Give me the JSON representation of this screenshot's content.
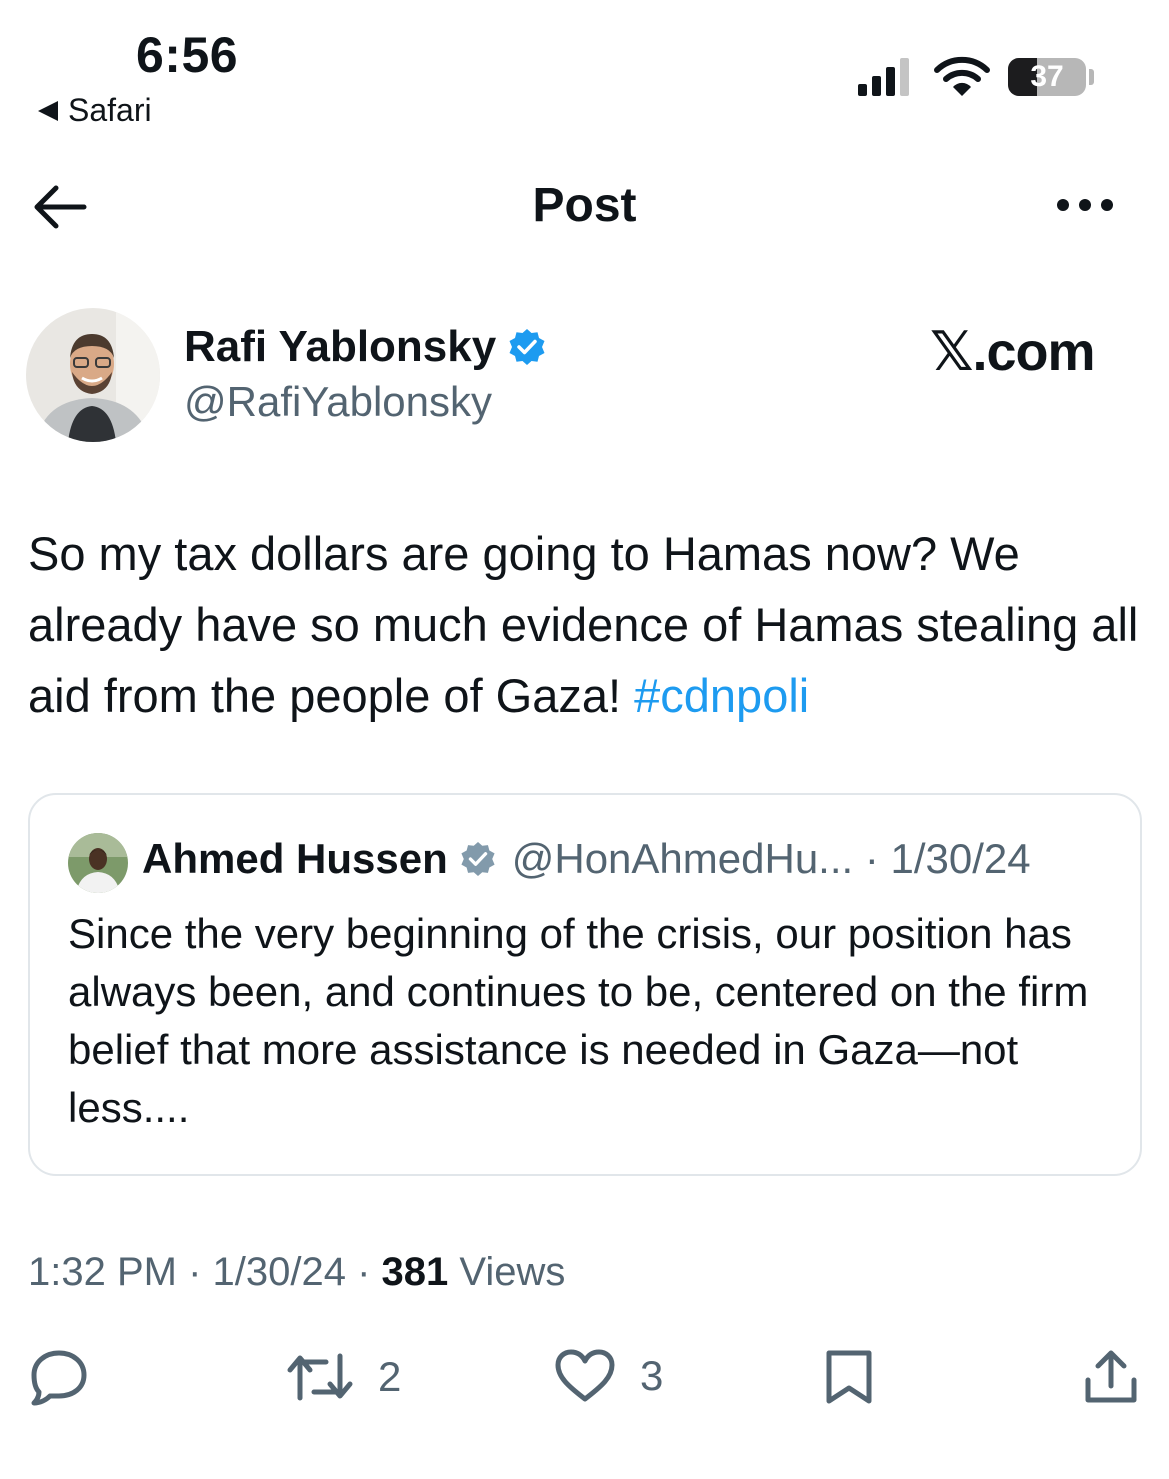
{
  "status_bar": {
    "time": "6:56",
    "back_app": "Safari",
    "battery_level": "37",
    "battery_fraction": 0.37
  },
  "header": {
    "title": "Post"
  },
  "author": {
    "name": "Rafi Yablonsky",
    "handle": "@RafiYablonsky"
  },
  "watermark": "𝕏.com",
  "post": {
    "text": "So my tax dollars are going to Hamas now? We already have so much evidence of Hamas stealing all aid from the people of Gaza! ",
    "hashtag": "#cdnpoli"
  },
  "quote": {
    "name": "Ahmed Hussen",
    "handle_and_date": "@HonAhmedHu... · 1/30/24",
    "text": "Since the very beginning of the crisis, our position has always been, and continues to be, centered on the firm belief that more assistance is needed in Gaza—not less...."
  },
  "meta": {
    "time": "1:32 PM",
    "separator": " · ",
    "date": "1/30/24",
    "views_count": "381",
    "views_label": " Views"
  },
  "actions": {
    "retweet_count": "2",
    "like_count": "3"
  },
  "colors": {
    "accent": "#1d9bf0",
    "text": "#0f1419",
    "secondary": "#536471",
    "border": "#e1e6ea"
  }
}
